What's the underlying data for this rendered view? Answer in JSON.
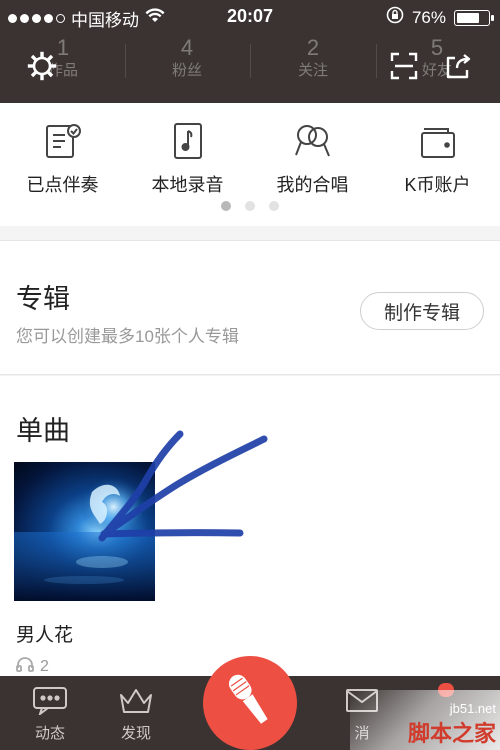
{
  "status_bar": {
    "carrier": "中国移动",
    "time": "20:07",
    "battery": "76%",
    "battery_level": 0.76
  },
  "profile_stats": [
    {
      "count": "1",
      "label": "作品"
    },
    {
      "count": "4",
      "label": "粉丝"
    },
    {
      "count": "2",
      "label": "关注"
    },
    {
      "count": "5",
      "label": "好友"
    }
  ],
  "header_icons": {
    "left": "gear-icon",
    "scan": "scan-icon",
    "share": "share-icon"
  },
  "shortcuts": [
    {
      "label": "已点伴奏",
      "icon": "ordered-accompaniment-icon"
    },
    {
      "label": "本地录音",
      "icon": "local-recording-icon"
    },
    {
      "label": "我的合唱",
      "icon": "chorus-icon"
    },
    {
      "label": "K币账户",
      "icon": "wallet-icon"
    }
  ],
  "pager": {
    "pages": 3,
    "active": 0
  },
  "albums": {
    "title": "专辑",
    "subtitle": "您可以创建最多10张个人专辑",
    "button": "制作专辑"
  },
  "singles": {
    "title": "单曲",
    "song": {
      "title": "男人花",
      "plays": "2"
    }
  },
  "tabbar": {
    "tabs": [
      {
        "label": "动态",
        "icon": "chat-icon"
      },
      {
        "label": "发现",
        "icon": "crown-icon"
      },
      {
        "label": "消",
        "icon": "mail-icon"
      }
    ],
    "record_icon": "microphone-icon"
  },
  "watermark": {
    "url": "jb51.net",
    "text": "脚本之家"
  },
  "colors": {
    "header_bg": "#3a3331",
    "accent": "#ee4f43",
    "annotation": "#1f3fa8"
  }
}
